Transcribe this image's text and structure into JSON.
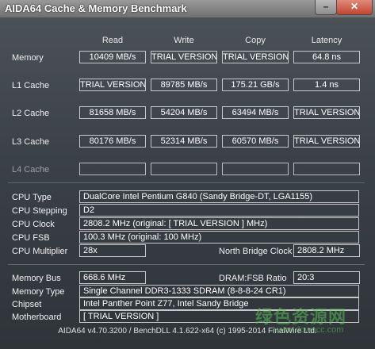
{
  "window": {
    "title": "AIDA64 Cache & Memory Benchmark",
    "minimize": "–",
    "close": "✕"
  },
  "columns": [
    "Read",
    "Write",
    "Copy",
    "Latency"
  ],
  "rows": [
    {
      "label": "Memory",
      "read": "10409 MB/s",
      "write": "TRIAL VERSION",
      "copy": "TRIAL VERSION",
      "latency": "64.8 ns"
    },
    {
      "label": "L1 Cache",
      "read": "TRIAL VERSION",
      "write": "89785 MB/s",
      "copy": "175.21 GB/s",
      "latency": "1.4 ns"
    },
    {
      "label": "L2 Cache",
      "read": "81658 MB/s",
      "write": "54204 MB/s",
      "copy": "63494 MB/s",
      "latency": "TRIAL VERSION"
    },
    {
      "label": "L3 Cache",
      "read": "80176 MB/s",
      "write": "52314 MB/s",
      "copy": "60570 MB/s",
      "latency": "TRIAL VERSION"
    },
    {
      "label": "L4 Cache",
      "read": "",
      "write": "",
      "copy": "",
      "latency": ""
    }
  ],
  "cpu": {
    "type_label": "CPU Type",
    "type": "DualCore Intel Pentium G840  (Sandy Bridge-DT, LGA1155)",
    "stepping_label": "CPU Stepping",
    "stepping": "D2",
    "clock_label": "CPU Clock",
    "clock": "2808.2 MHz  (original: [ TRIAL VERSION ] MHz)",
    "fsb_label": "CPU FSB",
    "fsb": "100.3 MHz  (original: 100 MHz)",
    "multiplier_label": "CPU Multiplier",
    "multiplier": "28x",
    "nb_clock_label": "North Bridge Clock",
    "nb_clock": "2808.2 MHz"
  },
  "memory": {
    "bus_label": "Memory Bus",
    "bus": "668.6 MHz",
    "ratio_label": "DRAM:FSB Ratio",
    "ratio": "20:3",
    "type_label": "Memory Type",
    "type": "Single Channel DDR3-1333 SDRAM  (8-8-8-24 CR1)",
    "chipset_label": "Chipset",
    "chipset": "Intel Panther Point Z77, Intel Sandy Bridge",
    "motherboard_label": "Motherboard",
    "motherboard": "[ TRIAL VERSION ]"
  },
  "footer": "AIDA64 v4.70.3200 / BenchDLL 4.1.622-x64  (c) 1995-2014 FinalWire Ltd.",
  "watermark": {
    "text": "绿色资源网",
    "sub": "www.downcc.com"
  }
}
